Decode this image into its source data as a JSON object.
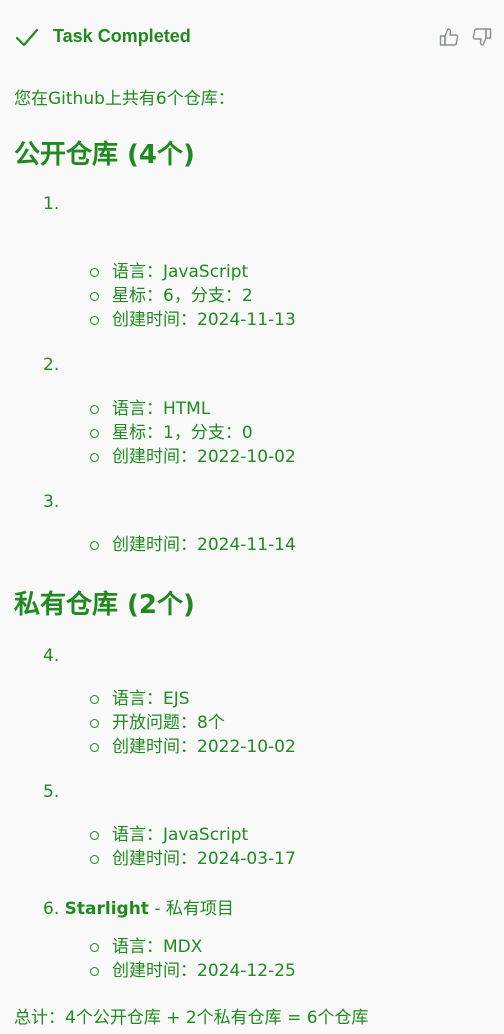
{
  "header": {
    "title": "Task Completed",
    "status_icon": "check-icon",
    "like_icon": "thumbs-up-icon",
    "dislike_icon": "thumbs-down-icon",
    "accent": "#1f8a1f"
  },
  "intro": "您在Github上共有6个仓库：",
  "public": {
    "heading": "公开仓库 (4个)",
    "items": [
      {
        "number": "1.",
        "bullets": [
          "语言：JavaScript",
          "星标：6，分支：2",
          "创建时间：2024-11-13"
        ]
      },
      {
        "number": "2.",
        "bullets": [
          "语言：HTML",
          "星标：1，分支：0",
          "创建时间：2022-10-02"
        ]
      },
      {
        "number": "3.",
        "bullets": [
          "创建时间：2024-11-14"
        ]
      }
    ]
  },
  "private": {
    "heading": "私有仓库 (2个)",
    "items": [
      {
        "number": "4.",
        "bullets": [
          "语言：EJS",
          "开放问题：8个",
          "创建时间：2022-10-02"
        ]
      },
      {
        "number": "5.",
        "bullets": [
          "语言：JavaScript",
          "创建时间：2024-03-17"
        ]
      },
      {
        "number": "6.",
        "name": "Starlight",
        "desc": " - 私有项目",
        "bullets": [
          "语言：MDX",
          "创建时间：2024-12-25"
        ]
      }
    ]
  },
  "total": "总计：4个公开仓库 + 2个私有仓库 = 6个仓库"
}
